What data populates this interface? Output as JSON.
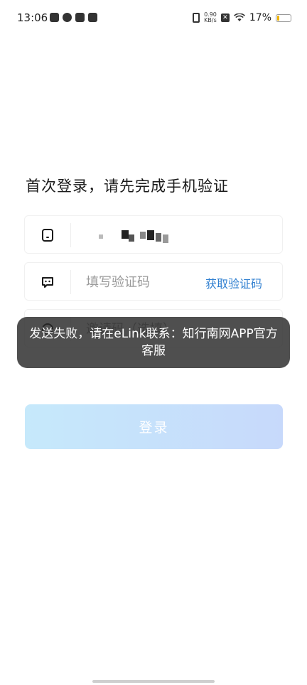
{
  "status_bar": {
    "time": "13:06",
    "net_speed_value": "0.90",
    "net_speed_unit": "KB/s",
    "battery_percent": "17%",
    "battery_level": 0.17
  },
  "page": {
    "title": "首次登录，请先完成手机验证"
  },
  "phone_field": {
    "icon": "phone-icon",
    "value": ""
  },
  "code_field": {
    "icon": "message-icon",
    "placeholder": "填写验证码",
    "get_code_label": "获取验证码"
  },
  "invite_field": {
    "icon": "invite-icon",
    "placeholder": "邀请码（选填）"
  },
  "login_button": {
    "label": "登录"
  },
  "toast": {
    "message": "发送失败，请在eLink联系：知行南网APP官方客服"
  },
  "colors": {
    "accent": "#2f7fd0",
    "button_gradient_start": "#c6e9fb",
    "button_gradient_end": "#c7d9fb",
    "toast_bg": "#282828"
  }
}
